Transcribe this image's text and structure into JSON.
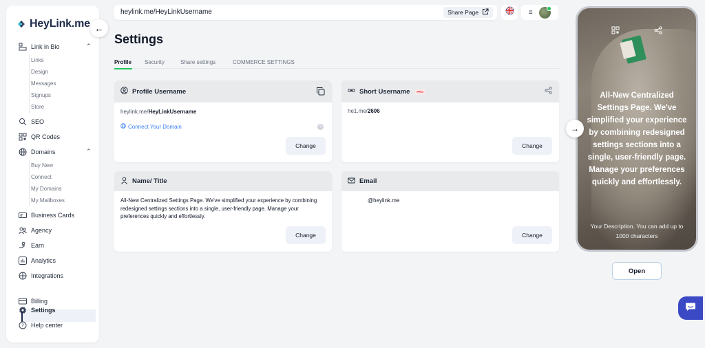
{
  "brand": {
    "name": "HeyLink.me"
  },
  "sidebar": {
    "link_in_bio": "Link in Bio",
    "link_sub": [
      "Links",
      "Design",
      "Messages",
      "Signups",
      "Store"
    ],
    "seo": "SEO",
    "qr_codes": "QR Codes",
    "domains": "Domains",
    "domain_sub": [
      "Buy New",
      "Connect",
      "My Domains",
      "My Mailboxes"
    ],
    "business_cards": "Business Cards",
    "agency": "Agency",
    "earn": "Earn",
    "analytics": "Analytics",
    "integrations": "Integrations",
    "billing": "Billing",
    "settings": "Settings",
    "help_center": "Help center"
  },
  "header": {
    "url": "heylink.me/HeyLinkUsername",
    "share_label": "Share Page"
  },
  "page": {
    "title": "Settings",
    "tabs": [
      "Profile",
      "Security",
      "Share settings",
      "COMMERCE SETTINGS"
    ],
    "active_tab": "Profile"
  },
  "cards": {
    "profile_username": {
      "title": "Profile Username",
      "prefix": "heylink.me/",
      "username": "HeyLinkUsername",
      "connect_domain": "Connect Your Domain",
      "help": "?",
      "change": "Change"
    },
    "short_username": {
      "title": "Short Username",
      "badge": "PRO",
      "prefix": "he1.me/",
      "value": "2606",
      "change": "Change"
    },
    "name_title": {
      "title": "Name/ Title",
      "text": "All-New Centralized Settings Page. We've simplified your experience by combining redesigned settings sections into a single, user-friendly page. Manage your preferences quickly and effortlessly.",
      "change": "Change"
    },
    "email": {
      "title": "Email",
      "value": "@heylink.me",
      "change": "Change"
    }
  },
  "preview": {
    "headline": "All-New Centralized Settings Page. We've simplified your experience by combining redesigned settings sections into a single, user-friendly page. Manage your preferences quickly and effortlessly.",
    "description": "Your Description. You can add up to 1000 characters",
    "open_label": "Open"
  },
  "colors": {
    "accent_green": "#22c55e",
    "brand_navy": "#1e2a4a",
    "chat_blue": "#3b4ac4",
    "pro_red": "#ef4444"
  }
}
